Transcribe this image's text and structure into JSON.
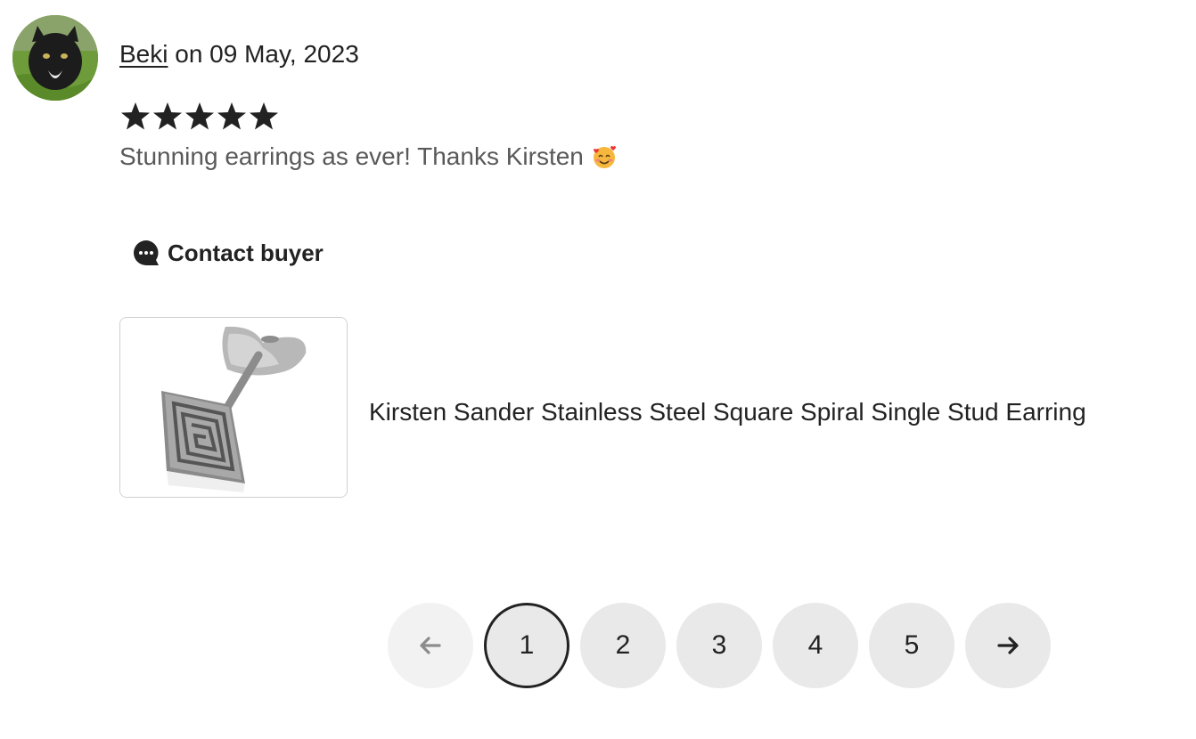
{
  "review": {
    "reviewer_name": "Beki",
    "date_text": " on 09 May, 2023",
    "rating": 5,
    "rating_max": 5,
    "text": "Stunning earrings as ever! Thanks Kirsten",
    "emoji": "smiling-face-with-hearts"
  },
  "contact": {
    "label": "Contact buyer"
  },
  "product": {
    "title": "Kirsten Sander Stainless Steel Square Spiral Single Stud Earring"
  },
  "pagination": {
    "pages": [
      "1",
      "2",
      "3",
      "4",
      "5"
    ],
    "current": "1",
    "prev_disabled": true
  },
  "colors": {
    "text": "#222222",
    "muted_text": "#595959",
    "page_bg": "#e9e9e9",
    "star": "#222222"
  }
}
